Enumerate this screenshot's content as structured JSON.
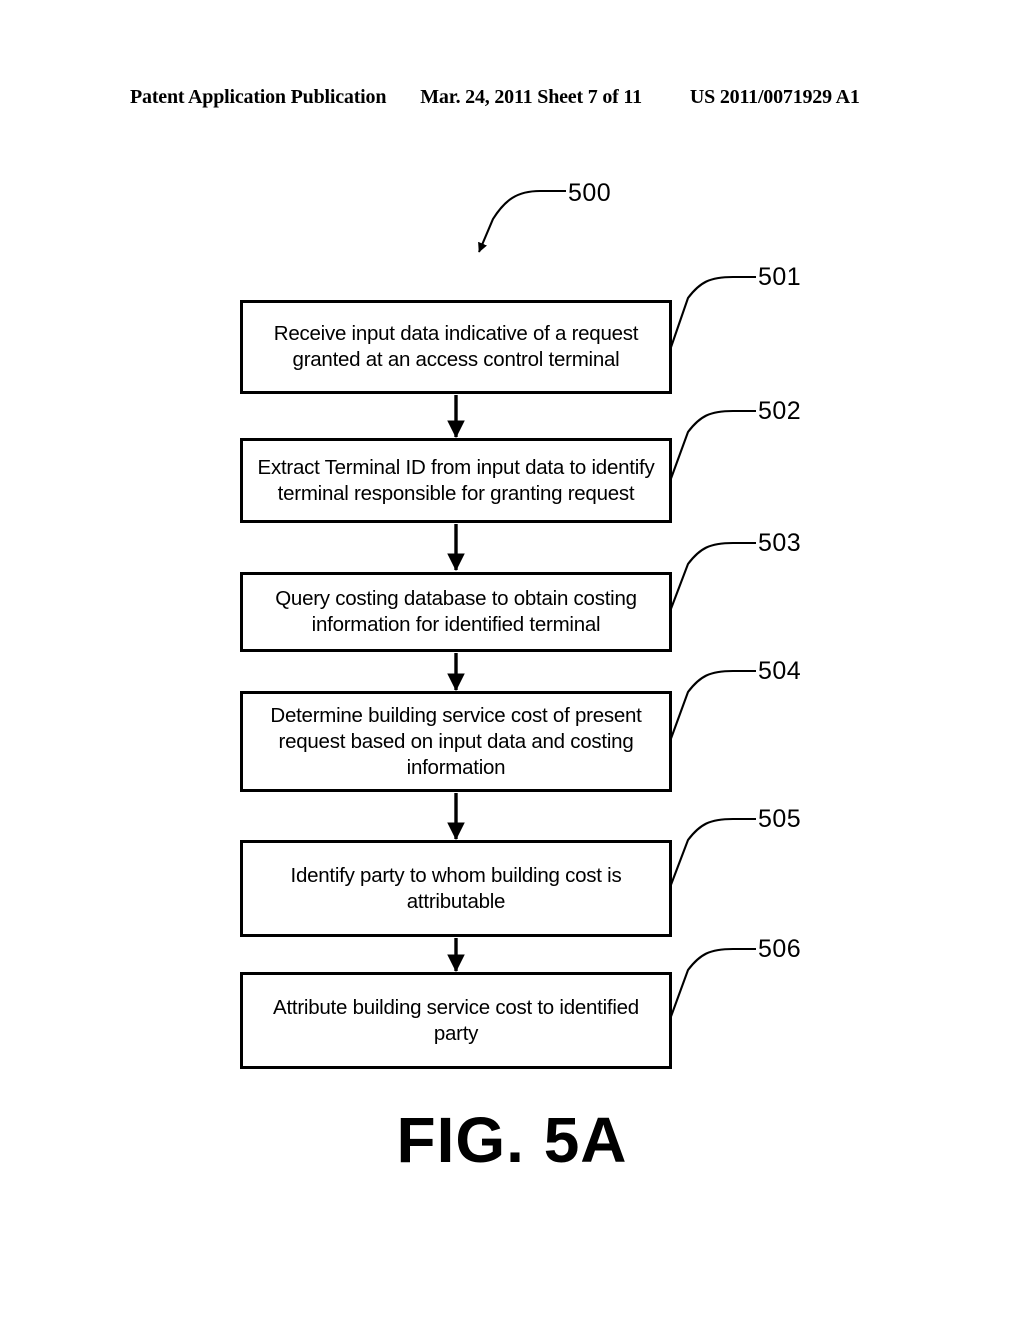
{
  "header": {
    "left": "Patent Application Publication",
    "middle": "Mar. 24, 2011  Sheet 7 of 11",
    "right": "US 2011/0071929 A1"
  },
  "figure": {
    "caption": "FIG. 5A",
    "flow_label": "500",
    "steps": [
      {
        "ref": "501",
        "text": "Receive input data indicative of a request granted at an access control terminal"
      },
      {
        "ref": "502",
        "text": "Extract Terminal ID from input data to identify terminal responsible for granting request"
      },
      {
        "ref": "503",
        "text": "Query costing database to obtain costing information for identified terminal"
      },
      {
        "ref": "504",
        "text": "Determine building service cost of present request based on input data and costing information"
      },
      {
        "ref": "505",
        "text": "Identify party to whom building cost is attributable"
      },
      {
        "ref": "506",
        "text": "Attribute building service cost to identified party"
      }
    ]
  },
  "colors": {
    "ink": "#000000",
    "paper": "#ffffff"
  }
}
